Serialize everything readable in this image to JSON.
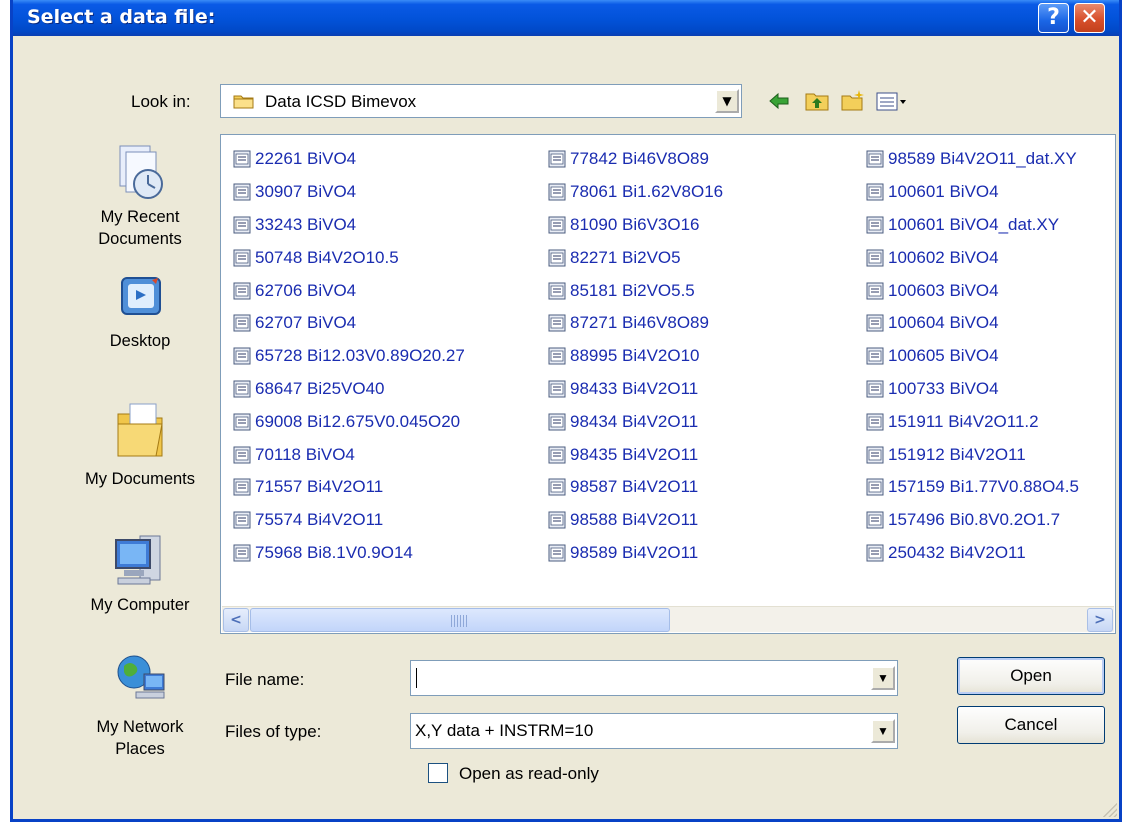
{
  "window": {
    "title": "Select a data file:",
    "help_button": "?",
    "close_button": "✕"
  },
  "look_in": {
    "label": "Look in:",
    "folder": "Data ICSD Bimevox"
  },
  "places": [
    {
      "icon": "recent-documents-icon",
      "label_line1": "My Recent",
      "label_line2": "Documents"
    },
    {
      "icon": "desktop-icon",
      "label_line1": "Desktop",
      "label_line2": ""
    },
    {
      "icon": "my-documents-icon",
      "label_line1": "My Documents",
      "label_line2": ""
    },
    {
      "icon": "my-computer-icon",
      "label_line1": "My Computer",
      "label_line2": ""
    },
    {
      "icon": "network-places-icon",
      "label_line1": "My Network",
      "label_line2": "Places"
    }
  ],
  "files": {
    "column1": [
      "22261 BiVO4",
      "30907 BiVO4",
      "33243 BiVO4",
      "50748 Bi4V2O10.5",
      "62706 BiVO4",
      "62707 BiVO4",
      "65728 Bi12.03V0.89O20.27",
      "68647 Bi25VO40",
      "69008 Bi12.675V0.045O20",
      "70118 BiVO4",
      "71557 Bi4V2O11",
      "75574 Bi4V2O11",
      "75968 Bi8.1V0.9O14"
    ],
    "column2": [
      "77842 Bi46V8O89",
      "78061 Bi1.62V8O16",
      "81090 Bi6V3O16",
      "82271 Bi2VO5",
      "85181 Bi2VO5.5",
      "87271 Bi46V8O89",
      "88995 Bi4V2O10",
      "98433 Bi4V2O11",
      "98434 Bi4V2O11",
      "98435 Bi4V2O11",
      "98587 Bi4V2O11",
      "98588 Bi4V2O11",
      "98589 Bi4V2O11"
    ],
    "column3": [
      "98589 Bi4V2O11_dat.XY",
      "100601 BiVO4",
      "100601 BiVO4_dat.XY",
      "100602 BiVO4",
      "100603 BiVO4",
      "100604 BiVO4",
      "100605 BiVO4",
      "100733 BiVO4",
      "151911 Bi4V2O11.2",
      "151912 Bi4V2O11",
      "157159 Bi1.77V0.88O4.5",
      "157496 Bi0.8V0.2O1.7",
      "250432 Bi4V2O11"
    ]
  },
  "file_name": {
    "label": "File name:",
    "value": ""
  },
  "files_of_type": {
    "label": "Files of type:",
    "value": "X,Y data + INSTRM=10"
  },
  "read_only": {
    "label": "Open as read-only",
    "checked": false
  },
  "buttons": {
    "open": "Open",
    "cancel": "Cancel"
  }
}
